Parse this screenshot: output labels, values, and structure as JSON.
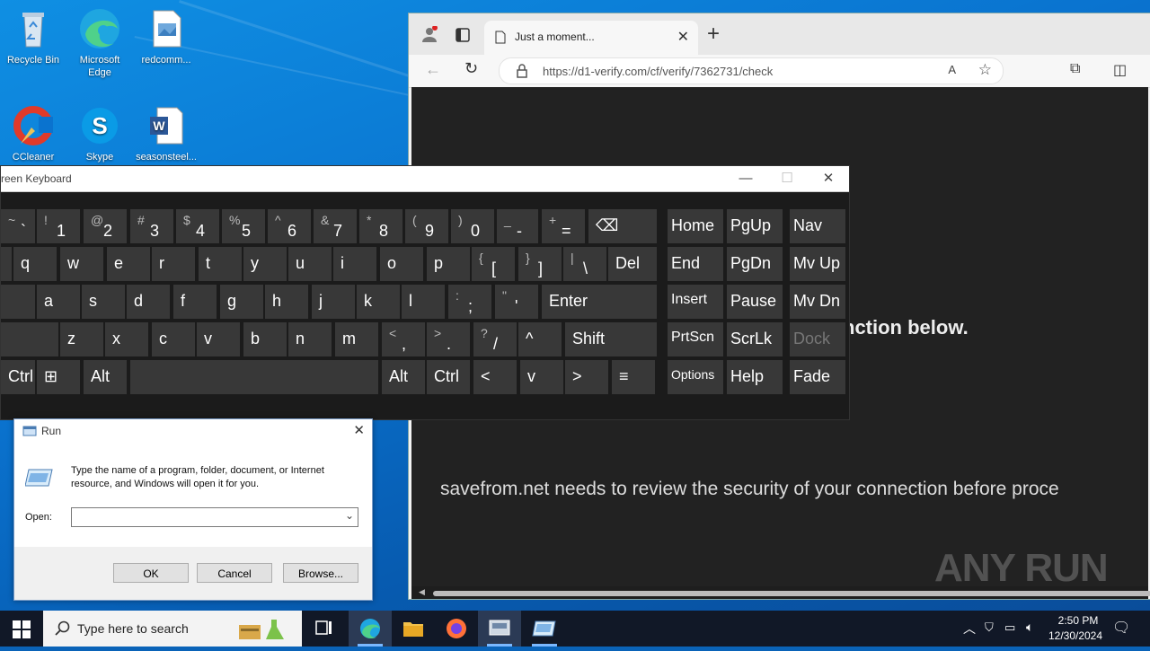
{
  "desktop": {
    "icons": [
      {
        "label": "Recycle Bin",
        "icon": "recycle-bin-icon"
      },
      {
        "label": "Microsoft Edge",
        "icon": "edge-icon"
      },
      {
        "label": "redcomm...",
        "icon": "image-file-icon"
      },
      {
        "label": "CCleaner",
        "icon": "ccleaner-icon"
      },
      {
        "label": "Skype",
        "icon": "skype-icon"
      },
      {
        "label": "seasonsteel...",
        "icon": "word-doc-icon"
      }
    ]
  },
  "browser": {
    "tab_title": "Just a moment...",
    "url": "https://d1-verify.com/cf/verify/7362731/check",
    "heading_partial": "nction below.",
    "paragraph": "savefrom.net needs to review the security of your connection before proce"
  },
  "osk": {
    "title": "reen Keyboard",
    "rows": [
      [
        {
          "s": "~",
          "m": "`"
        },
        {
          "s": "!",
          "m": "1"
        },
        {
          "s": "@",
          "m": "2"
        },
        {
          "s": "#",
          "m": "3"
        },
        {
          "s": "$",
          "m": "4"
        },
        {
          "s": "%",
          "m": "5"
        },
        {
          "s": "^",
          "m": "6"
        },
        {
          "s": "&",
          "m": "7"
        },
        {
          "s": "*",
          "m": "8"
        },
        {
          "s": "(",
          "m": "9"
        },
        {
          "s": ")",
          "m": "0"
        },
        {
          "s": "_",
          "m": "-"
        },
        {
          "s": "+",
          "m": "="
        },
        {
          "m": "⌫"
        }
      ],
      [
        {
          "m": "q"
        },
        {
          "m": "w"
        },
        {
          "m": "e"
        },
        {
          "m": "r"
        },
        {
          "m": "t"
        },
        {
          "m": "y"
        },
        {
          "m": "u"
        },
        {
          "m": "i"
        },
        {
          "m": "o"
        },
        {
          "m": "p"
        },
        {
          "s": "{",
          "m": "["
        },
        {
          "s": "}",
          "m": "]"
        },
        {
          "s": "|",
          "m": "\\"
        },
        {
          "m": "Del"
        }
      ],
      [
        {
          "m": "a"
        },
        {
          "m": "s"
        },
        {
          "m": "d"
        },
        {
          "m": "f"
        },
        {
          "m": "g"
        },
        {
          "m": "h"
        },
        {
          "m": "j"
        },
        {
          "m": "k"
        },
        {
          "m": "l"
        },
        {
          "s": ":",
          "m": ";"
        },
        {
          "s": "\"",
          "m": "'"
        },
        {
          "m": "Enter"
        }
      ],
      [
        {
          "m": "z"
        },
        {
          "m": "x"
        },
        {
          "m": "c"
        },
        {
          "m": "v"
        },
        {
          "m": "b"
        },
        {
          "m": "n"
        },
        {
          "m": "m"
        },
        {
          "s": "<",
          "m": ","
        },
        {
          "s": ">",
          "m": "."
        },
        {
          "s": "?",
          "m": "/"
        },
        {
          "m": "^"
        },
        {
          "m": "Shift"
        }
      ],
      [
        {
          "m": "Ctrl"
        },
        {
          "m": "⊞"
        },
        {
          "m": "Alt"
        },
        {
          "m": ""
        },
        {
          "m": "Alt"
        },
        {
          "m": "Ctrl"
        },
        {
          "m": "<"
        },
        {
          "m": "v"
        },
        {
          "m": ">"
        },
        {
          "m": "≡"
        }
      ]
    ],
    "nav_keys": [
      [
        "Home",
        "PgUp",
        "Nav"
      ],
      [
        "End",
        "PgDn",
        "Mv Up"
      ],
      [
        "Insert",
        "Pause",
        "Mv Dn"
      ],
      [
        "PrtScn",
        "ScrLk",
        "Dock"
      ],
      [
        "Options",
        "Help",
        "Fade"
      ]
    ]
  },
  "run": {
    "title": "Run",
    "description": "Type the name of a program, folder, document, or Internet resource, and Windows will open it for you.",
    "open_label": "Open:",
    "open_value": "",
    "ok": "OK",
    "cancel": "Cancel",
    "browse": "Browse..."
  },
  "taskbar": {
    "search_placeholder": "Type here to search",
    "time": "2:50 PM",
    "date": "12/30/2024"
  },
  "watermark": "ANY RUN"
}
